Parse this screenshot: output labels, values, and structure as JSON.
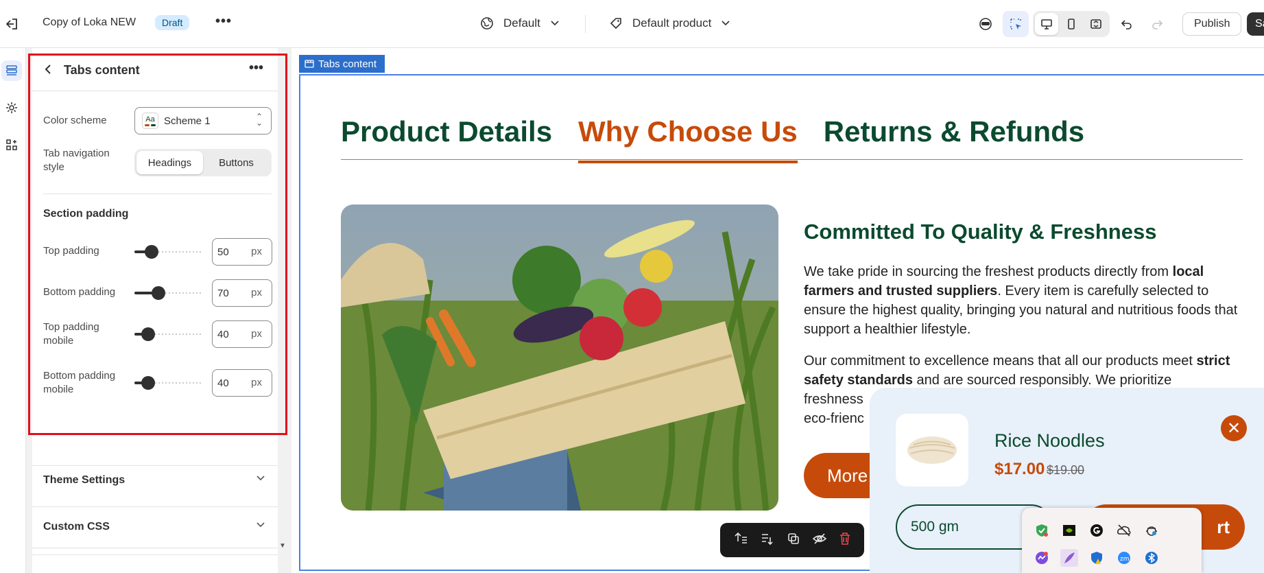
{
  "topbar": {
    "title": "Copy of Loka NEW",
    "badge": "Draft",
    "more": "•••",
    "theme_selector": "Default",
    "template_selector": "Default product",
    "publish_label": "Publish",
    "save_label": "Sa"
  },
  "panel": {
    "title": "Tabs content",
    "more": "•••",
    "color_scheme_label": "Color scheme",
    "color_scheme_icon": "Aa",
    "color_scheme_value": "Scheme 1",
    "tab_nav_label_1": "Tab navigation",
    "tab_nav_label_2": "style",
    "tab_nav_options": [
      "Headings",
      "Buttons"
    ],
    "tab_nav_selected": "Headings",
    "section_padding_heading": "Section padding",
    "paddings": [
      {
        "label": "Top padding",
        "label2": "",
        "value": "50",
        "unit": "px",
        "fraction": 0.25
      },
      {
        "label": "Bottom padding",
        "label2": "",
        "value": "70",
        "unit": "px",
        "fraction": 0.35
      },
      {
        "label": "Top padding",
        "label2": "mobile",
        "value": "40",
        "unit": "px",
        "fraction": 0.2
      },
      {
        "label": "Bottom padding",
        "label2": "mobile",
        "value": "40",
        "unit": "px",
        "fraction": 0.2
      }
    ],
    "accordions": [
      "Theme Settings",
      "Custom CSS"
    ]
  },
  "canvas": {
    "section_tag": "Tabs content",
    "tabs": [
      "Product Details",
      "Why Choose Us",
      "Returns & Refunds"
    ],
    "active_tab": "Why Choose Us",
    "heading": "Committed To Quality & Freshness",
    "p1_a": "We take pride in sourcing the freshest products directly from ",
    "p1_b": "local farmers and trusted suppliers",
    "p1_c": ". Every item is carefully selected to ensure the highest quality, bringing you natural and nutritious foods that support a healthier lifestyle.",
    "p2_a": "Our commitment to excellence means that all our products meet ",
    "p2_b": "strict safety standards",
    "p2_c": " and are sourced responsibly. We prioritize",
    "p2_d": "freshness",
    "p2_e": "eco-frienc",
    "more_button": "More",
    "brand_colors": {
      "green": "#0b4a2e",
      "orange": "#c64b0a"
    }
  },
  "popup": {
    "product_name": "Rice Noodles",
    "price": "$17.00",
    "compare_price": "$19.00",
    "variant": "500 gm",
    "cart_button": "rt"
  },
  "tray_icons": [
    "security-check-icon",
    "nvidia-icon",
    "grammarly-icon",
    "cloud-off-icon",
    "bug-icon",
    "messenger-icon",
    "feather-icon",
    "shield-warning-icon",
    "zoom-icon",
    "bluetooth-icon"
  ]
}
